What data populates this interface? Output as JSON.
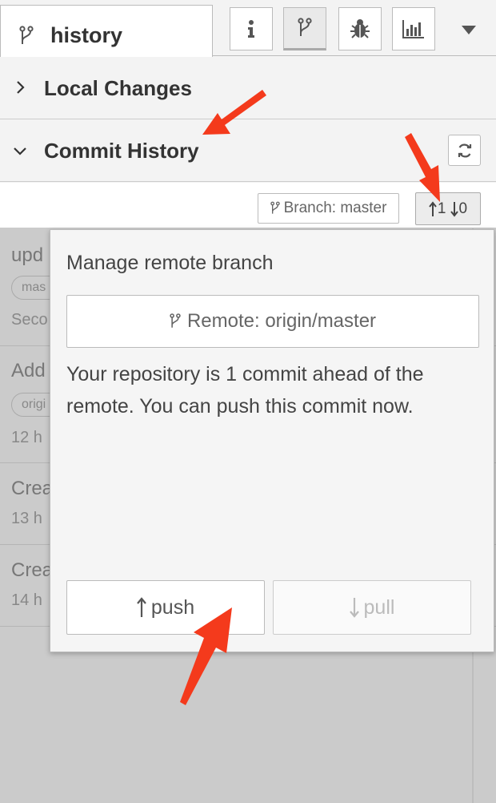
{
  "tab": {
    "title": "history"
  },
  "toolbar": {
    "icons": [
      "info-icon",
      "branch-icon",
      "bug-icon",
      "chart-icon",
      "caret-down-icon"
    ]
  },
  "sections": {
    "local_changes": "Local Changes",
    "commit_history": "Commit History"
  },
  "branch_bar": {
    "branch_label": "Branch: master",
    "ahead": "1",
    "behind": "0"
  },
  "commits": [
    {
      "title": "upd",
      "tag": "mas",
      "time": "Seco"
    },
    {
      "title": "Add",
      "tag": "origi",
      "time": "12 h"
    },
    {
      "title": "Crea",
      "time": "13 h"
    },
    {
      "title": "Crea",
      "time": "14 h"
    }
  ],
  "popover": {
    "heading": "Manage remote branch",
    "remote_label": "Remote: origin/master",
    "message": "Your repository is 1 commit ahead of the remote. You can push this commit now.",
    "push_label": "push",
    "pull_label": "pull"
  },
  "colors": {
    "annotation_arrow": "#f43a1c",
    "overlay": "#cbcbcb",
    "panel_bg": "#f3f3f3"
  }
}
